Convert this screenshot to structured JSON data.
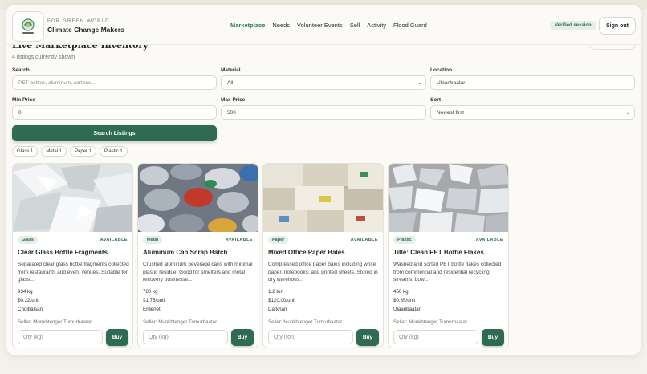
{
  "app": {
    "org_sub": "FOR GREEN WORLD",
    "org_title": "Climate Change Makers"
  },
  "nav": {
    "items": [
      "Marketplace",
      "Needs",
      "Volunteer Events",
      "Sell",
      "Activity",
      "Flood Guard"
    ],
    "active": "Marketplace"
  },
  "session": {
    "badge": "Verified session",
    "signout_label": "Sign out"
  },
  "section": {
    "title": "Live Marketplace Inventory",
    "count_text": "4 listings currently shown"
  },
  "filters": {
    "search_label": "Search",
    "search_placeholder": "PET bottles, aluminum, cartons...",
    "material_label": "Material",
    "material_value": "All",
    "location_label": "Location",
    "location_value": "Ulaanbaatar",
    "min_price_label": "Min Price",
    "min_price_value": "0",
    "max_price_label": "Max Price",
    "max_price_value": "500",
    "sort_label": "Sort",
    "sort_value": "Newest first",
    "search_button": "Search Listings"
  },
  "chips": [
    "Glass 1",
    "Metal 1",
    "Paper 1",
    "Plastic 1"
  ],
  "listings": [
    {
      "tag": "Glass",
      "status": "AVAILABLE",
      "title": "Clear Glass Bottle Fragments",
      "desc": "Separated clear glass bottle fragments collected from restaurants and event venues. Suitable for glass...",
      "quantity": "934 kg",
      "price": "$0.22/unit",
      "location": "Choibalsan",
      "seller": "Seller: Munkhtenger Tumurbaatar",
      "qty_placeholder": "Qty (kg)",
      "buy_label": "Buy"
    },
    {
      "tag": "Metal",
      "status": "AVAILABLE",
      "title": "Aluminum Can Scrap Batch",
      "desc": "Crushed aluminum beverage cans with minimal plastic residue. Good for smelters and metal recovery businesse...",
      "quantity": "780 kg",
      "price": "$1.75/unit",
      "location": "Erdenet",
      "seller": "Seller: Munkhtenger Tumurbaatar",
      "qty_placeholder": "Qty (kg)",
      "buy_label": "Buy"
    },
    {
      "tag": "Paper",
      "status": "AVAILABLE",
      "title": "Mixed Office Paper Bales",
      "desc": "Compressed office paper bales including white paper, notebooks, and printed sheets. Stored in dry warehous...",
      "quantity": "1.2 ton",
      "price": "$120.00/unit",
      "location": "Darkhan",
      "seller": "Seller: Munkhtenger Tumurbaatar",
      "qty_placeholder": "Qty (ton)",
      "buy_label": "Buy"
    },
    {
      "tag": "Plastic",
      "status": "AVAILABLE",
      "title": "Title: Clean PET Bottle Flakes",
      "desc": "Washed and sorted PET bottle flakes collected from commercial and residential recycling streams. Low...",
      "quantity": "450 kg",
      "price": "$0.85/unit",
      "location": "Ulaanbaatar",
      "seller": "Seller: Munkhtenger Tumurbaatar",
      "qty_placeholder": "Qty (kg)",
      "buy_label": "Buy"
    }
  ],
  "colors": {
    "accent": "#2f6b52",
    "accent_light": "#e3efe7",
    "page_bg": "#fbfaf6"
  }
}
